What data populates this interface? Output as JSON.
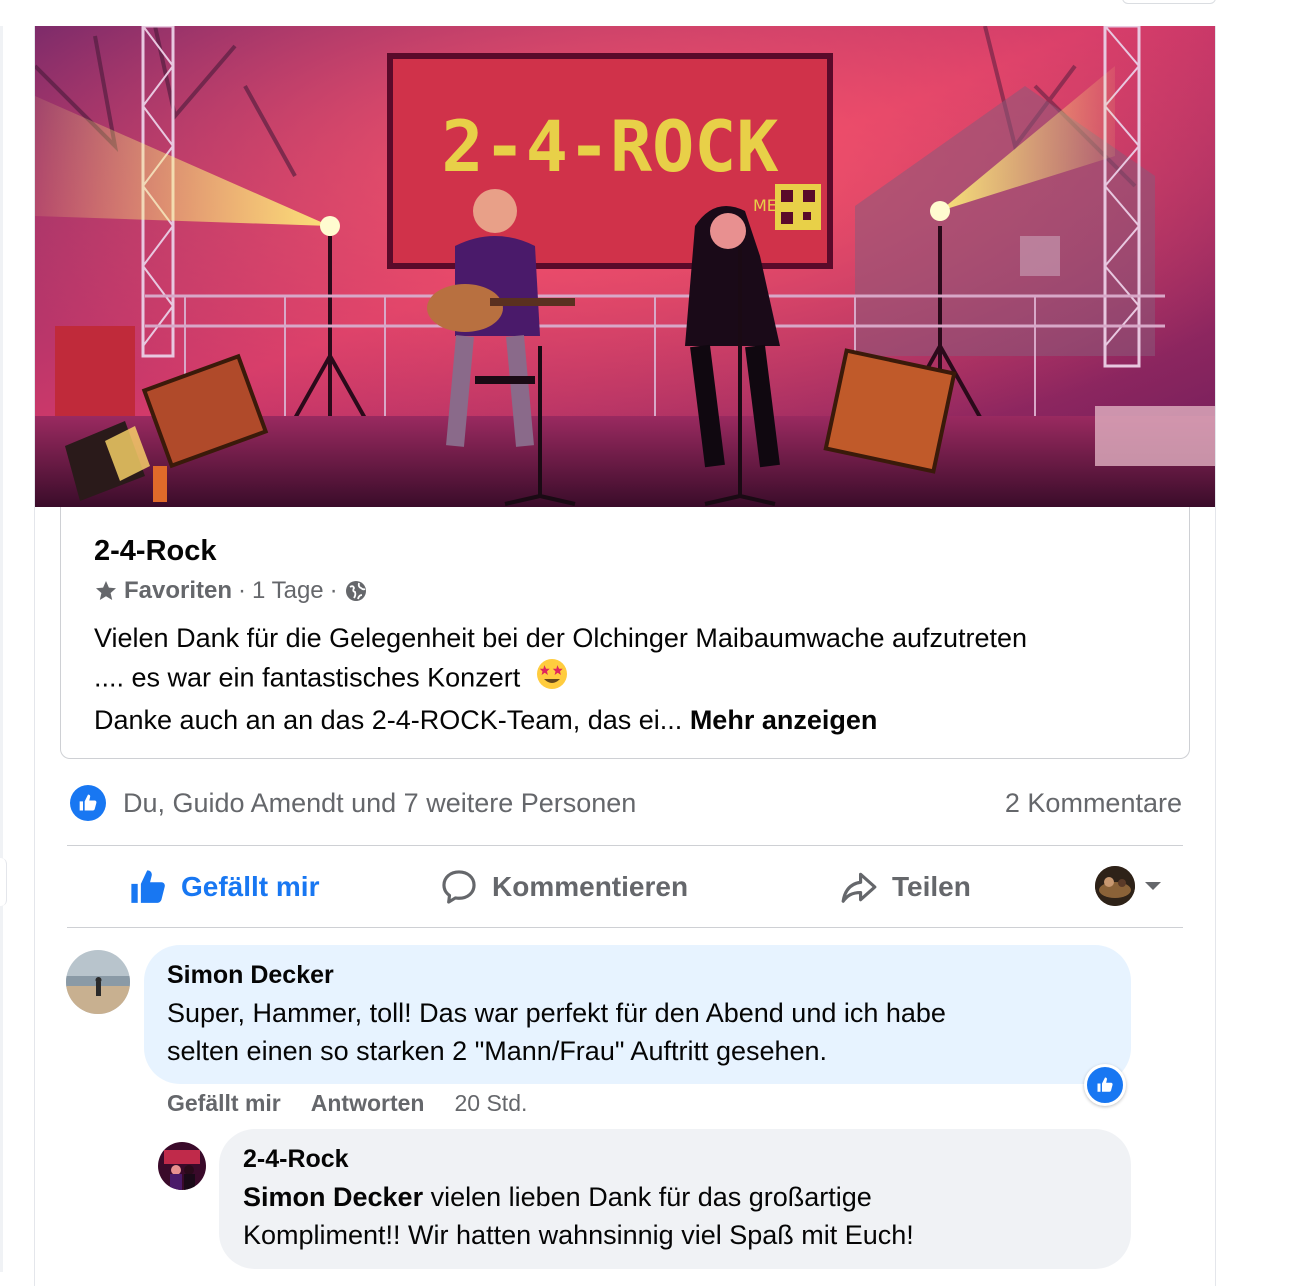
{
  "post_photo": {
    "banner_text": "2-4-ROCK",
    "banner_small": "ME"
  },
  "shared_post": {
    "page_name": "2-4-Rock",
    "favorites_label": "Favoriten",
    "time": "1 Tage",
    "text_line1": "Vielen Dank für die Gelegenheit bei der Olchinger Maibaumwache aufzutreten",
    "text_line2": ".... es war ein fantastisches  Konzert",
    "text_line3": "Danke auch an an das 2-4-ROCK-Team, das ei...",
    "more_label": "Mehr anzeigen"
  },
  "reactions": {
    "summary": "Du, Guido Amendt und 7 weitere Personen",
    "comments_count": "2 Kommentare"
  },
  "actions": {
    "like": "Gefällt mir",
    "comment": "Kommentieren",
    "share": "Teilen"
  },
  "comments": [
    {
      "author": "Simon Decker",
      "line1": "Super, Hammer, toll! Das war perfekt für den Abend und ich habe",
      "line2": "selten einen so starken 2 \"Mann/Frau\" Auftritt gesehen.",
      "like_label": "Gefällt mir",
      "reply_label": "Antworten",
      "time": "20 Std."
    },
    {
      "author": "2-4-Rock",
      "mention": "Simon Decker",
      "line1_rest": " vielen lieben Dank für das großartige",
      "line2": "Kompliment!! Wir hatten wahnsinnig viel Spaß mit Euch!"
    }
  ],
  "colors": {
    "accent": "#1877f2",
    "secondary_text": "#65676b",
    "bubble": "#f0f2f5",
    "bubble_highlight": "#e7f3ff"
  }
}
